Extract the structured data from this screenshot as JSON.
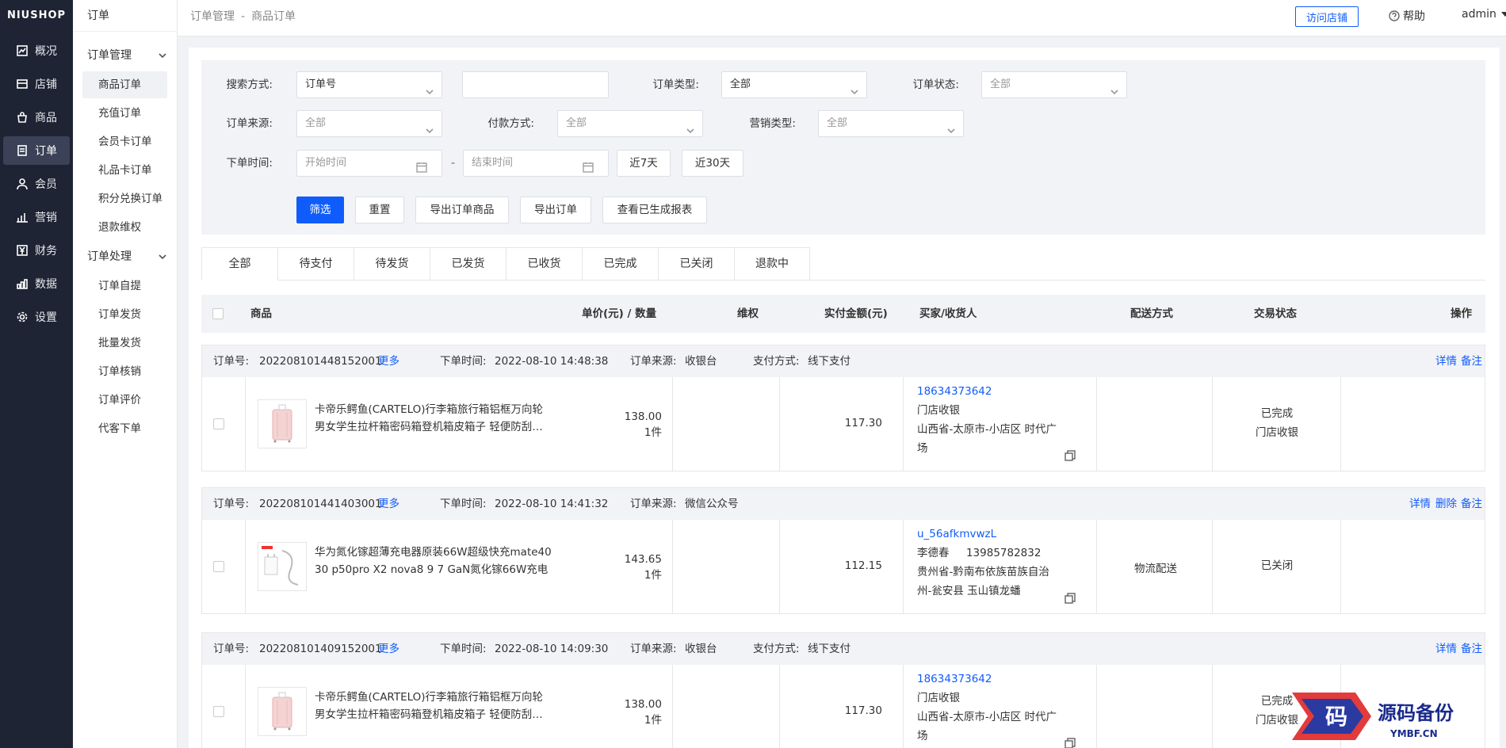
{
  "nav": {
    "logo": "NIUSHOP",
    "items": [
      {
        "label": "概况",
        "icon": "chart-icon"
      },
      {
        "label": "店铺",
        "icon": "store-icon"
      },
      {
        "label": "商品",
        "icon": "bag-icon"
      },
      {
        "label": "订单",
        "icon": "order-icon"
      },
      {
        "label": "会员",
        "icon": "user-icon"
      },
      {
        "label": "营销",
        "icon": "bars-icon"
      },
      {
        "label": "财务",
        "icon": "yen-icon"
      },
      {
        "label": "数据",
        "icon": "data-icon"
      },
      {
        "label": "设置",
        "icon": "gear-icon"
      }
    ],
    "active": 3
  },
  "subnav": {
    "title": "订单",
    "groups": [
      {
        "title": "订单管理",
        "items": [
          "商品订单",
          "充值订单",
          "会员卡订单",
          "礼品卡订单",
          "积分兑换订单",
          "退款维权"
        ]
      },
      {
        "title": "订单处理",
        "items": [
          "订单自提",
          "订单发货",
          "批量发货",
          "订单核销",
          "订单评价",
          "代客下单"
        ]
      }
    ]
  },
  "header": {
    "crumb1": "订单管理",
    "crumb_sep": "-",
    "crumb2": "商品订单",
    "visit_label": "访问店铺",
    "help_label": "帮助",
    "user": "admin"
  },
  "filter": {
    "search_mode_label": "搜索方式:",
    "search_mode_value": "订单号",
    "search_value": "",
    "order_type_label": "订单类型:",
    "order_type_value": "全部",
    "order_status_label": "订单状态:",
    "order_status_value": "全部",
    "source_label": "订单来源:",
    "source_value": "全部",
    "pay_label": "付款方式:",
    "pay_value": "全部",
    "promo_label": "营销类型:",
    "promo_value": "全部",
    "time_label": "下单时间:",
    "start_placeholder": "开始时间",
    "end_placeholder": "结束时间",
    "dash": "-",
    "last7": "近7天",
    "last30": "近30天",
    "btn_filter": "筛选",
    "btn_reset": "重置",
    "btn_export_goods": "导出订单商品",
    "btn_export_order": "导出订单",
    "btn_report": "查看已生成报表"
  },
  "tabs": [
    "全部",
    "待支付",
    "待发货",
    "已发货",
    "已收货",
    "已完成",
    "已关闭",
    "退款中"
  ],
  "table_head": {
    "goods": "商品",
    "price_qty": "单价(元) / 数量",
    "rights": "维权",
    "paid": "实付金额(元)",
    "buyer": "买家/收货人",
    "delivery": "配送方式",
    "status": "交易状态",
    "ops": "操作"
  },
  "labels": {
    "order_no": "订单号:",
    "more": "更多",
    "order_time": "下单时间:",
    "order_source": "订单来源:",
    "pay_method": "支付方式:",
    "detail": "详情",
    "delete": "删除",
    "remark": "备注"
  },
  "orders": [
    {
      "no": "202208101448152001",
      "time": "2022-08-10 14:48:38",
      "source": "收银台",
      "pay": "线下支付",
      "name_line1": "卡帝乐鳄鱼(CARTELO)行李箱旅行箱铝框万向轮",
      "name_line2": "男女学生拉杆箱密码箱登机箱皮箱子 轻便防刮…",
      "price": "138.00",
      "qty": "1件",
      "paid": "117.30",
      "buyer": "18634373642",
      "receiver": "门店收银",
      "addr1": "山西省-太原市-小店区 时代广",
      "addr2": "场",
      "delivery": "",
      "status1": "已完成",
      "status2": "门店收银"
    },
    {
      "no": "202208101441403001",
      "time": "2022-08-10 14:41:32",
      "source": "微信公众号",
      "pay": "",
      "name_line1": "华为氮化镓超薄充电器原装66W超级快充mate40",
      "name_line2": "30 p50pro X2 nova8 9 7 GaN氮化镓66W充电",
      "price": "143.65",
      "qty": "1件",
      "paid": "112.15",
      "buyer": "u_56afkmvwzL",
      "receiver": "李德春     13985782832",
      "addr1": "贵州省-黔南布依族苗族自治",
      "addr2": "州-瓮安县 玉山镇龙蟠",
      "delivery": "物流配送",
      "status1": "已关闭",
      "status2": ""
    },
    {
      "no": "202208101409152001",
      "time": "2022-08-10 14:09:30",
      "source": "收银台",
      "pay": "线下支付",
      "name_line1": "卡帝乐鳄鱼(CARTELO)行李箱旅行箱铝框万向轮",
      "name_line2": "男女学生拉杆箱密码箱登机箱皮箱子 轻便防刮…",
      "price": "138.00",
      "qty": "1件",
      "paid": "117.30",
      "buyer": "18634373642",
      "receiver": "门店收银",
      "addr1": "山西省-太原市-小店区 时代广",
      "addr2": "场",
      "delivery": "",
      "status1": "已完成",
      "status2": "门店收银"
    }
  ],
  "watermark": {
    "char": "码",
    "title": "源码备份",
    "url": "YMBF.CN"
  },
  "colors": {
    "primary": "#105cfb",
    "nav_bg": "#1e2433"
  }
}
